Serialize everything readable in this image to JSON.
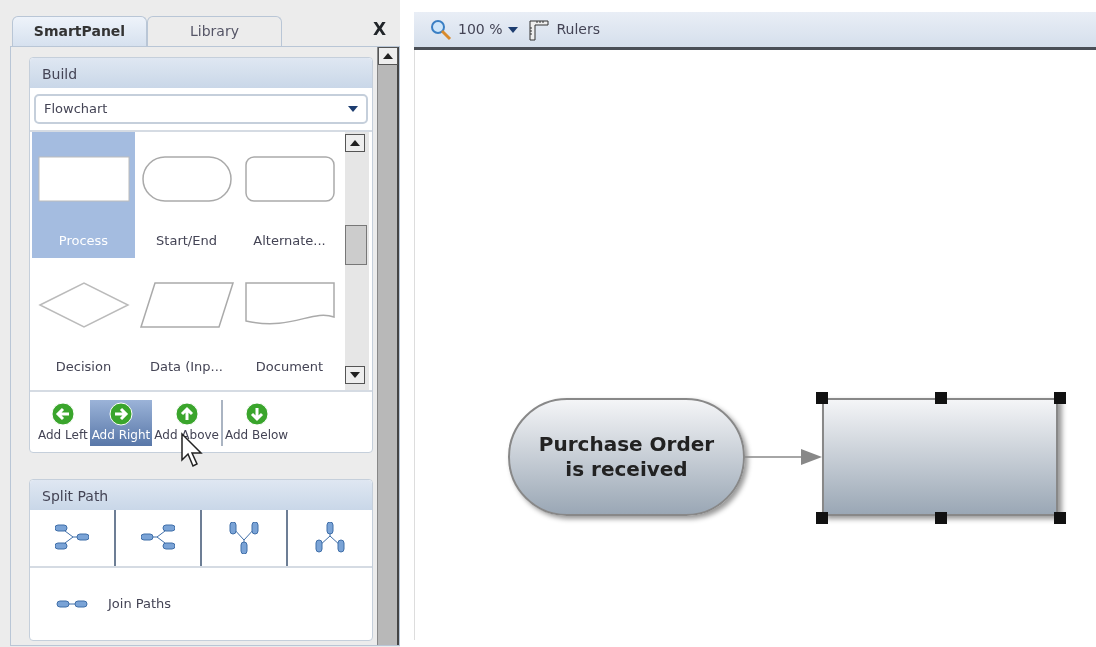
{
  "tabs": [
    {
      "label": "SmartPanel",
      "selected": true
    },
    {
      "label": "Library",
      "selected": false
    }
  ],
  "close": "X",
  "build": {
    "title": "Build",
    "dropdown": "Flowchart",
    "shapes": [
      {
        "label": "Process",
        "kind": "process",
        "selected": true
      },
      {
        "label": "Start/End",
        "kind": "terminal",
        "selected": false
      },
      {
        "label": "Alternate...",
        "kind": "alternate",
        "selected": false
      },
      {
        "label": "Decision",
        "kind": "decision",
        "selected": false
      },
      {
        "label": "Data (Inp...",
        "kind": "data",
        "selected": false
      },
      {
        "label": "Document",
        "kind": "document",
        "selected": false
      }
    ],
    "actions": [
      {
        "label": "Add Left",
        "kind": "left",
        "selected": false
      },
      {
        "label": "Add Right",
        "kind": "right",
        "selected": true
      },
      {
        "label": "Add Above",
        "kind": "up",
        "selected": false
      },
      {
        "label": "Add Below",
        "kind": "down",
        "selected": false
      }
    ]
  },
  "split_path": {
    "title": "Split Path",
    "options": [
      {
        "kind": "right"
      },
      {
        "kind": "left"
      },
      {
        "kind": "up"
      },
      {
        "kind": "down"
      }
    ],
    "join": "Join Paths"
  },
  "toolbar": {
    "zoom": "100 %",
    "rulers": "Rulers"
  },
  "canvas": {
    "nodes": [
      {
        "kind": "terminal",
        "lines": [
          "Purchase Order",
          "is received"
        ],
        "selected": false
      },
      {
        "kind": "process",
        "selected": true
      }
    ]
  }
}
